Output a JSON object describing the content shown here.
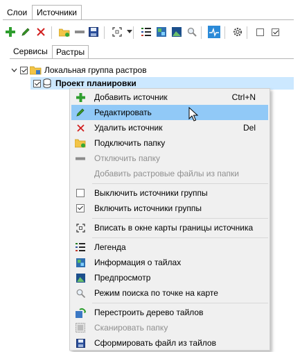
{
  "tabs": {
    "layers": "Слои",
    "sources": "Источники"
  },
  "sub_tabs": {
    "services": "Сервисы",
    "rasters": "Растры"
  },
  "tree": {
    "group_label": "Локальная группа растров",
    "project_label": "Проект планировки"
  },
  "menu": {
    "add": {
      "label": "Добавить источник",
      "shortcut": "Ctrl+N"
    },
    "edit": {
      "label": "Редактировать"
    },
    "delete": {
      "label": "Удалить источник",
      "shortcut": "Del"
    },
    "connect_folder": {
      "label": "Подключить папку"
    },
    "disconnect_folder": {
      "label": "Отключить папку"
    },
    "add_rasters": {
      "label": "Добавить растровые файлы из папки"
    },
    "disable_group": {
      "label": "Выключить источники группы"
    },
    "enable_group": {
      "label": "Включить источники группы"
    },
    "fit_bounds": {
      "label": "Вписать в окне карты границы источника"
    },
    "legend": {
      "label": "Легенда"
    },
    "tile_info": {
      "label": "Информация о тайлах"
    },
    "preview": {
      "label": "Предпросмотр"
    },
    "point_search": {
      "label": "Режим поиска по точке на карте"
    },
    "rebuild_tree": {
      "label": "Перестроить дерево тайлов"
    },
    "scan_folder": {
      "label": "Сканировать папку"
    },
    "make_file": {
      "label": "Сформировать файл из тайлов"
    }
  },
  "colors": {
    "accent_green": "#2e9e2e",
    "delete_red": "#d11f1f",
    "hover": "#91c9f7",
    "selected": "#cce8ff"
  }
}
